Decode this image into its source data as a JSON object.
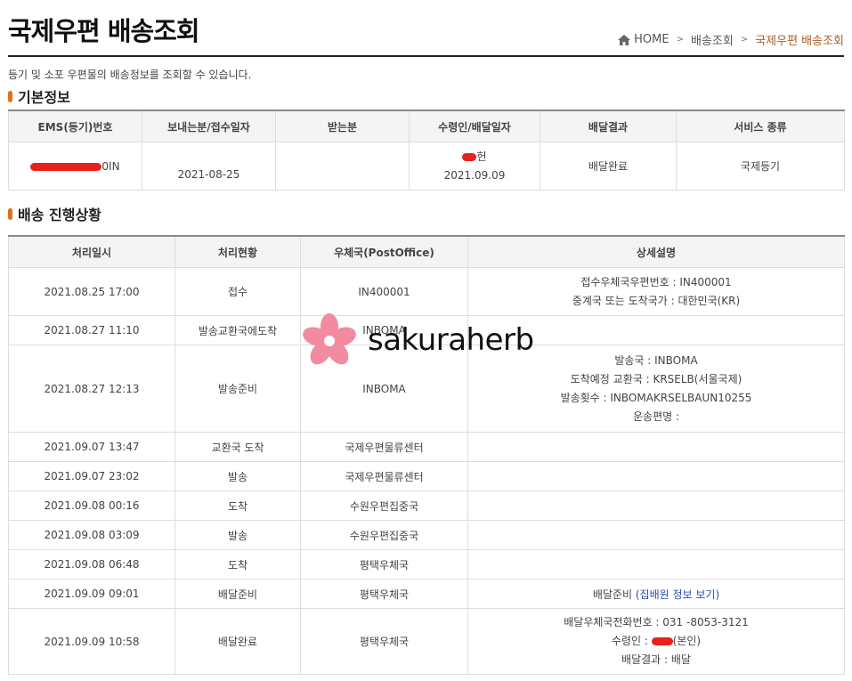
{
  "header": {
    "title": "국제우편 배송조회",
    "breadcrumb": [
      "HOME",
      "배송조회",
      "국제우편 배송조회"
    ],
    "description": "등기 및 소포 우편물의 배송정보를 조회할 수 있습니다."
  },
  "basic": {
    "heading": "기본정보",
    "columns": [
      "EMS(등기)번호",
      "보내는분/접수일자",
      "받는분",
      "수령인/배달일자",
      "배달결과",
      "서비스 종류"
    ],
    "row": {
      "ems_number_suffix": "0IN",
      "sender_date": "2021-08-25",
      "recipient": "",
      "receiver_suffix": "헌",
      "delivery_date": "2021.09.09",
      "result": "배달완료",
      "service": "국제등기"
    }
  },
  "progress": {
    "heading": "배송 진행상황",
    "columns": [
      "처리일시",
      "처리현황",
      "우체국(PostOffice)",
      "상세설명"
    ],
    "rows": [
      {
        "datetime": "2021.08.25 17:00",
        "status": "접수",
        "office": "IN400001",
        "details": [
          "접수우체국우편번호 : IN400001",
          "중계국 또는 도착국가 : 대한민국(KR)"
        ]
      },
      {
        "datetime": "2021.08.27 11:10",
        "status": "발송교환국에도착",
        "office": "INBOMA",
        "details": []
      },
      {
        "datetime": "2021.08.27 12:13",
        "status": "발송준비",
        "office": "INBOMA",
        "details": [
          "발송국 : INBOMA",
          "도착예정 교환국 : KRSELB(서울국제)",
          "발송횟수 : INBOMAKRSELBAUN10255",
          "운송편명 :"
        ]
      },
      {
        "datetime": "2021.09.07 13:47",
        "status": "교환국 도착",
        "office": "국제우편물류센터",
        "details": []
      },
      {
        "datetime": "2021.09.07 23:02",
        "status": "발송",
        "office": "국제우편물류센터",
        "details": []
      },
      {
        "datetime": "2021.09.08 00:16",
        "status": "도착",
        "office": "수원우편집중국",
        "details": []
      },
      {
        "datetime": "2021.09.08 03:09",
        "status": "발송",
        "office": "수원우편집중국",
        "details": []
      },
      {
        "datetime": "2021.09.08 06:48",
        "status": "도착",
        "office": "평택우체국",
        "details": []
      },
      {
        "datetime": "2021.09.09 09:01",
        "status": "배달준비",
        "office": "평택우체국",
        "details": []
      },
      {
        "datetime": "2021.09.09 10:58",
        "status": "배달완료",
        "office": "평택우체국",
        "details": [
          "배달우체국전화번호 : 031 -8053-3121",
          "배달결과 : 배달"
        ]
      }
    ],
    "row9_detail_prefix": "배달준비",
    "row9_detail_link": "(집배원 정보 보기)",
    "row10_receiver_prefix": "수령인 :",
    "row10_receiver_suffix": "(본인)"
  },
  "watermark": {
    "text": "sakuraherb"
  },
  "colors": {
    "accent": "#e0701b",
    "breadcrumb_current": "#a8612a",
    "redaction": "#e8211f",
    "link": "#2b4ea8"
  }
}
